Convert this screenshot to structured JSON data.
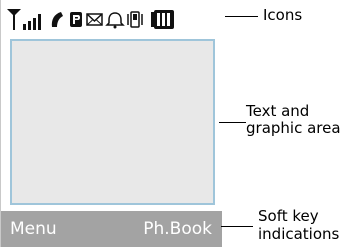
{
  "softkeys": {
    "left": "Menu",
    "right": "Ph.Book"
  },
  "callouts": {
    "icons": "Icons",
    "text_area_line1": "Text and",
    "text_area_line2": "graphic area",
    "softkey_line1": "Soft key",
    "softkey_line2": "indications"
  },
  "status_icons": [
    "signal-strength-icon",
    "call-icon",
    "roaming-icon",
    "message-icon",
    "alarm-icon",
    "vibration-icon",
    "battery-icon"
  ],
  "colors": {
    "softkey_bar": "#a3a3a3",
    "display_background": "#e8e8e8",
    "display_border": "#9fc5da",
    "softkey_text": "#ffffff"
  }
}
